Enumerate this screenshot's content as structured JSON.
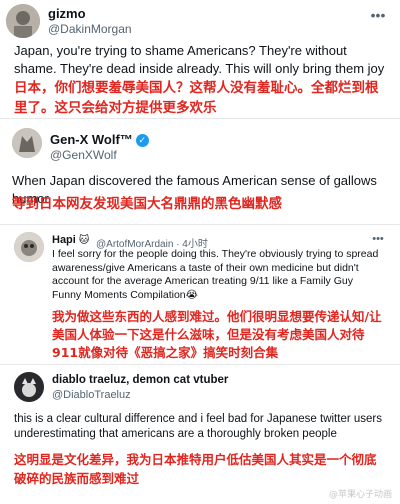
{
  "posts": [
    {
      "name": "gizmo",
      "handle": "@DakinMorgan",
      "text": "Japan, you're trying to shame Americans? They're without shame. They're dead inside already. This will only bring them joy",
      "translation": "日本，你们想要羞辱美国人？这帮人没有羞耻心。全都烂到根里了。这只会给对方提供更多欢乐"
    },
    {
      "name": "Gen-X Wolf™",
      "handle": "@GenXWolf",
      "verified": "✓",
      "text": "When Japan discovered the famous American sense of gallows humor.",
      "translation": "等到日本网友发现美国大名鼎鼎的黑色幽默感"
    },
    {
      "name": "Hapi",
      "emoji": "🐱",
      "handle": "@ArtofMorArdain · 4小时",
      "text": "I feel sorry for the people doing this. They're obviously trying to spread awareness/give Americans a taste of their own medicine but didn't account for the average American treating 9/11 like a Family Guy Funny Moments Compilation😭",
      "translation": "我为做这些东西的人感到难过。他们很明显想要传递认知/让美国人体验一下这是什么滋味，但是没有考虑美国人对待911就像对待《恶搞之家》搞笑时刻合集"
    },
    {
      "name": "diablo traeluz, demon cat vtuber",
      "handle": "@DiabloTraeluz",
      "text": "this is a clear cultural difference and i feel bad for Japanese twitter users underestimating that americans are a thoroughly broken people",
      "translation": "这明显是文化差异，我为日本推特用户低估美国人其实是一个彻底破碎的民族而感到难过"
    }
  ],
  "watermark": "@苹果心子动画",
  "icons": {
    "more": "more-horizontal-icon",
    "verified": "verified-badge-icon"
  },
  "colors": {
    "translation": "#e0261f",
    "handle": "#536471",
    "verified": "#1d9bf0"
  }
}
